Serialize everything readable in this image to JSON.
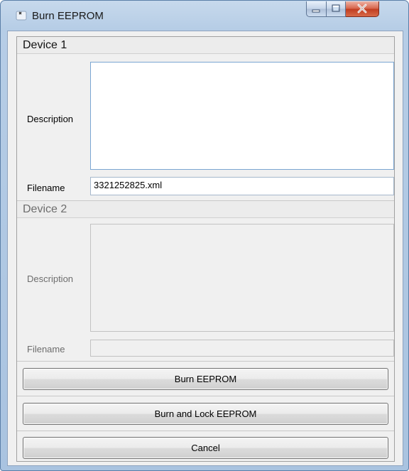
{
  "window": {
    "title": "Burn EEPROM",
    "controls": {
      "minimize": "minimize-icon",
      "maximize": "maximize-icon",
      "close": "close-icon"
    }
  },
  "device1": {
    "header": "Device 1",
    "description_label": "Description",
    "description_value": "",
    "filename_label": "Filename",
    "filename_value": "3321252825.xml"
  },
  "device2": {
    "header": "Device 2",
    "description_label": "Description",
    "description_value": "",
    "filename_label": "Filename",
    "filename_value": ""
  },
  "buttons": {
    "burn": "Burn EEPROM",
    "burn_lock": "Burn and Lock EEPROM",
    "cancel": "Cancel"
  }
}
